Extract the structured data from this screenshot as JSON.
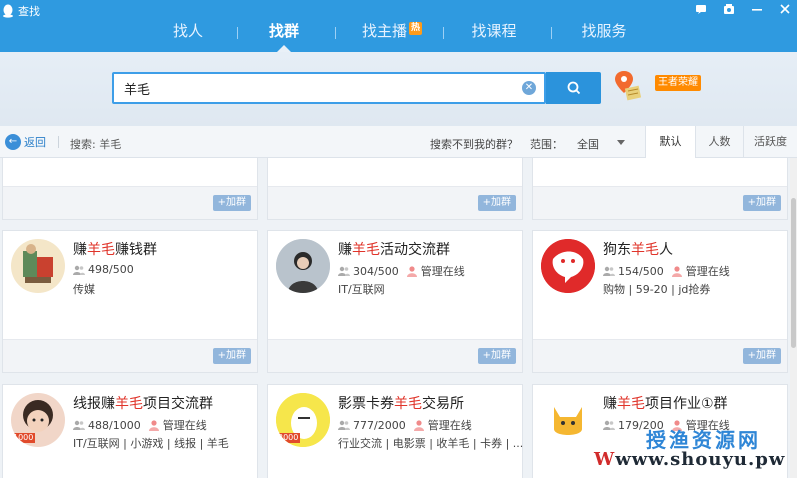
{
  "window": {
    "title": "查找"
  },
  "tabs": [
    {
      "label": "找人"
    },
    {
      "label": "找群"
    },
    {
      "label": "找主播",
      "badge": "热"
    },
    {
      "label": "找课程"
    },
    {
      "label": "找服务"
    }
  ],
  "search": {
    "value": "羊毛",
    "button_icon": "search-icon",
    "game_badge": "王者荣耀"
  },
  "filter": {
    "back_label": "返回",
    "search_label": "搜索: 羊毛",
    "notfound": "搜索不到我的群？",
    "range_label": "范围：",
    "range_value": "全国",
    "sort_tabs": [
      "默认",
      "人数",
      "活跃度"
    ]
  },
  "join_label": "+加群",
  "groups": [
    {
      "name_pre": "赚",
      "name_hl": "羊毛",
      "name_post": "赚钱群",
      "members": "498/500",
      "manager": "",
      "tags": "传媒"
    },
    {
      "name_pre": "赚",
      "name_hl": "羊毛",
      "name_post": "活动交流群",
      "members": "304/500",
      "manager": "管理在线",
      "tags": "IT/互联网"
    },
    {
      "name_pre": "狗东",
      "name_hl": "羊毛",
      "name_post": "人",
      "members": "154/500",
      "manager": "管理在线",
      "tags": "购物 | 59-20 | jd抢券"
    },
    {
      "name_pre": "线报赚",
      "name_hl": "羊毛",
      "name_post": "项目交流群",
      "members": "488/1000",
      "manager": "管理在线",
      "tags": "IT/互联网 | 小游戏 | 线报 | 羊毛",
      "level": "1000"
    },
    {
      "name_pre": "影票卡券",
      "name_hl": "羊毛",
      "name_post": "交易所",
      "members": "777/2000",
      "manager": "管理在线",
      "tags": "行业交流 | 电影票 | 收羊毛 | 卡券 | ...",
      "level": "2000"
    },
    {
      "name_pre": "赚",
      "name_hl": "羊毛",
      "name_post": "项目作业①群",
      "members": "179/200",
      "manager": "管理在线",
      "tags": ""
    }
  ],
  "watermark": {
    "cn": "授渔资源网",
    "url_w": "W",
    "url_rest": "www.shouyu.pw"
  },
  "colors": {
    "brand": "#2f9ae0",
    "highlight": "#e0342a",
    "join": "#92b6dc",
    "badge": "#ff8a00"
  }
}
